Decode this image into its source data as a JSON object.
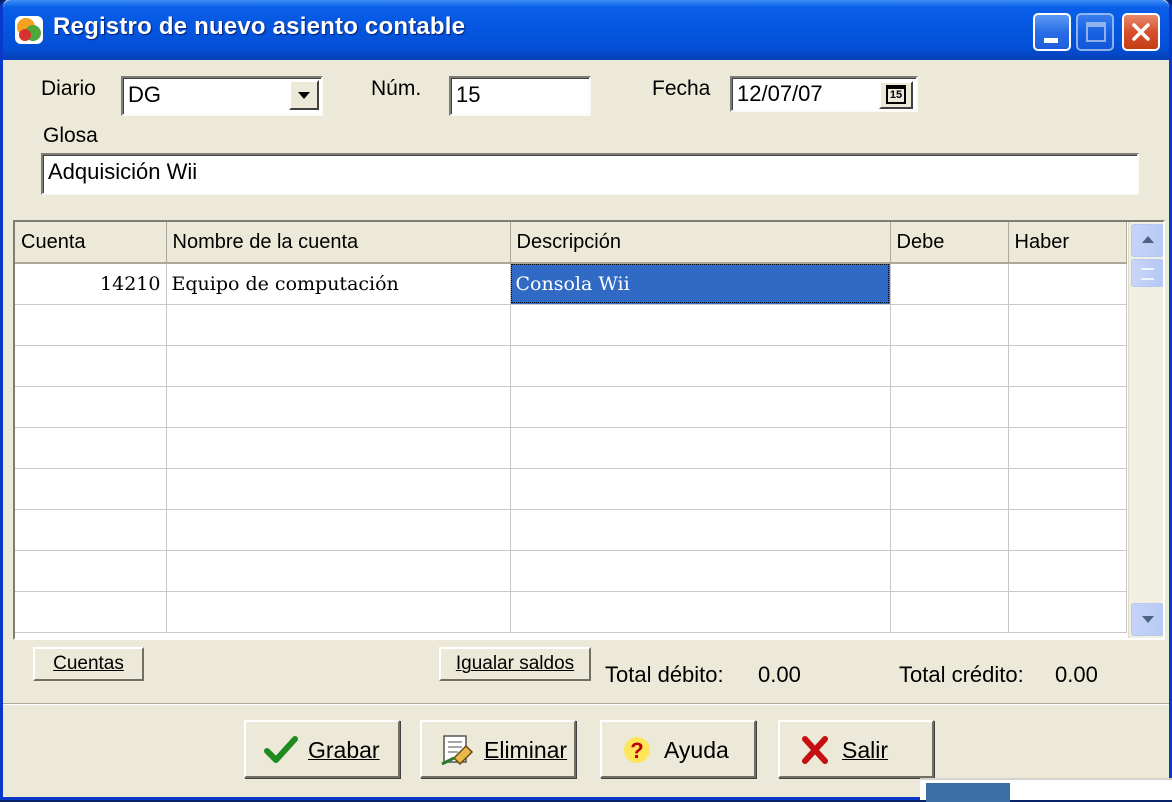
{
  "window": {
    "title": "Registro de nuevo asiento contable"
  },
  "header": {
    "diario_label": "Diario",
    "diario_value": "DG",
    "num_label": "Núm.",
    "num_value": "15",
    "fecha_label": "Fecha",
    "fecha_value": "12/07/07",
    "calendar_badge": "15",
    "glosa_label": "Glosa",
    "glosa_value": "Adquisición Wii"
  },
  "grid": {
    "columns": [
      "Cuenta",
      "Nombre de la cuenta",
      "Descripción",
      "Debe",
      "Haber"
    ],
    "rows": [
      [
        "14210",
        "Equipo de computación",
        "Consola Wii",
        "",
        ""
      ],
      [
        "",
        "",
        "",
        "",
        ""
      ],
      [
        "",
        "",
        "",
        "",
        ""
      ],
      [
        "",
        "",
        "",
        "",
        ""
      ],
      [
        "",
        "",
        "",
        "",
        ""
      ],
      [
        "",
        "",
        "",
        "",
        ""
      ],
      [
        "",
        "",
        "",
        "",
        ""
      ],
      [
        "",
        "",
        "",
        "",
        ""
      ],
      [
        "",
        "",
        "",
        "",
        ""
      ]
    ]
  },
  "footer": {
    "cuentas_button": "Cuentas",
    "igualar_button": "Igualar saldos",
    "total_debito_label": "Total débito:",
    "total_debito_value": "0.00",
    "total_credito_label": "Total crédito:",
    "total_credito_value": "0.00"
  },
  "actions": {
    "grabar": "Grabar",
    "eliminar": "Eliminar",
    "ayuda": "Ayuda",
    "salir": "Salir"
  },
  "colors": {
    "selection": "#316ac5",
    "titlebar": "#0556e0",
    "window_bg": "#ece9d8"
  }
}
